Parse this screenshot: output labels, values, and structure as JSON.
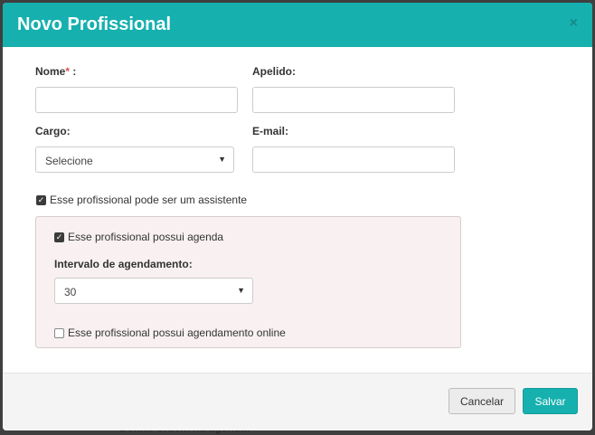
{
  "backdrop": {
    "text": "Definir ordem na agenda:"
  },
  "modal": {
    "title": "Novo Profissional",
    "close_label": "×"
  },
  "form": {
    "nome_label": "Nome",
    "required_mark": "*",
    "nome_suffix": " :",
    "nome_value": "",
    "apelido_label": "Apelido:",
    "apelido_value": "",
    "cargo_label": "Cargo:",
    "cargo_selected": "Selecione",
    "email_label": "E-mail:",
    "email_value": "",
    "assistente_label": "Esse profissional pode ser um assistente",
    "assistente_checked": true
  },
  "agenda_panel": {
    "agenda_label": "Esse profissional possui agenda",
    "agenda_checked": true,
    "intervalo_label": "Intervalo de agendamento:",
    "intervalo_selected": "30",
    "online_label": "Esse profissional possui agendamento online",
    "online_checked": false
  },
  "footer": {
    "cancel_label": "Cancelar",
    "save_label": "Salvar"
  },
  "colors": {
    "header": "#16b0af",
    "save_button": "#16b0af",
    "required": "#d9534f",
    "panel_bg": "#f9f1f1"
  }
}
